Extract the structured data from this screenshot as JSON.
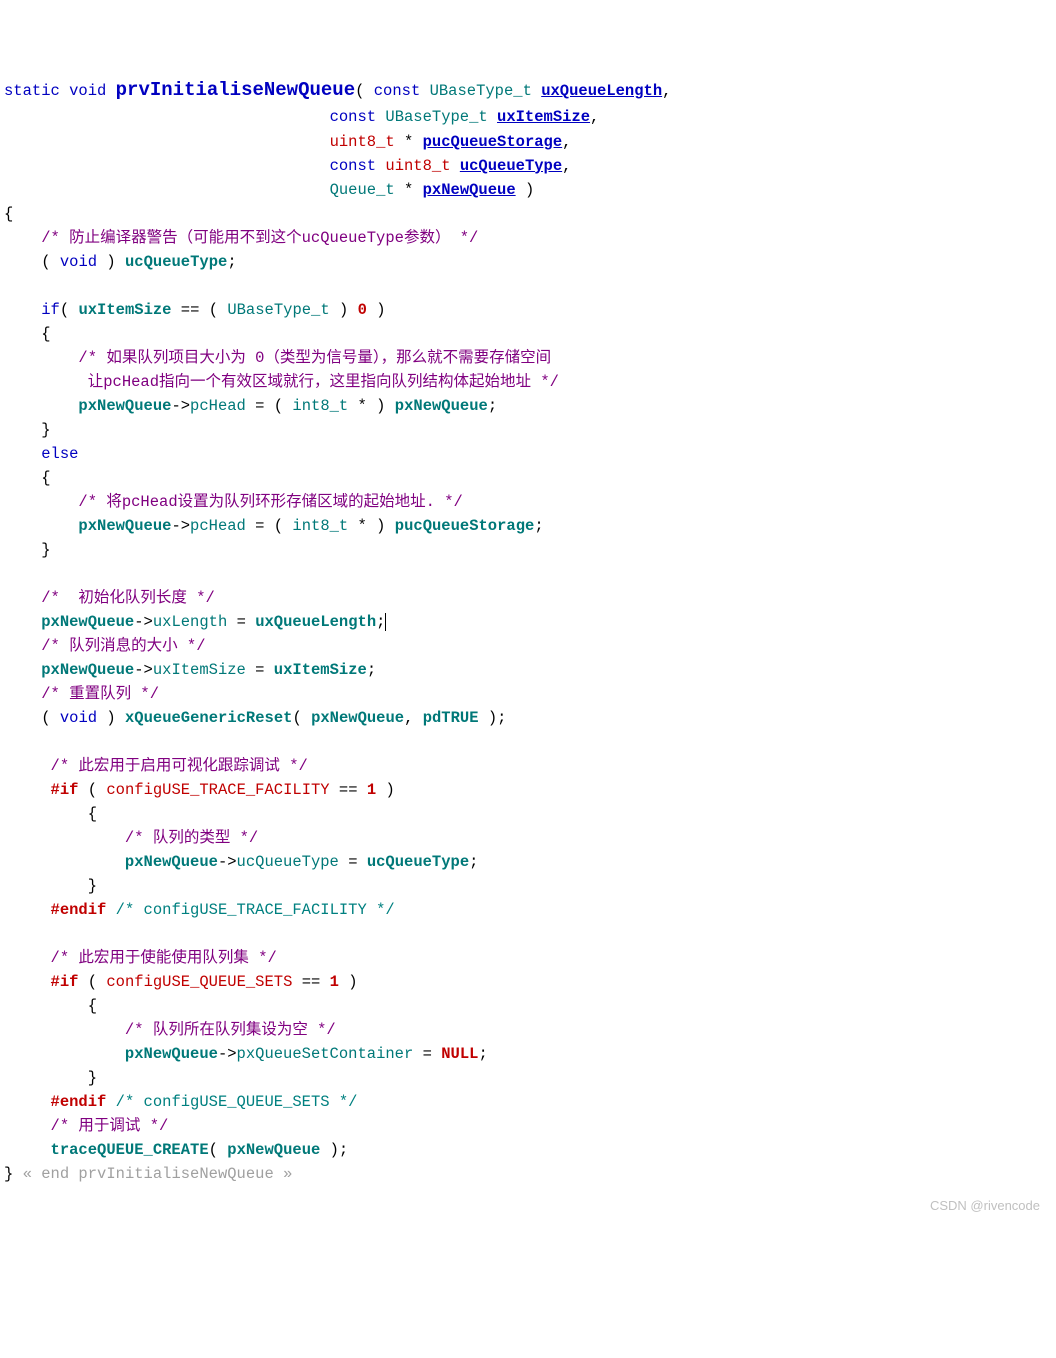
{
  "tokens": {
    "static": "static",
    "void": "void",
    "fnname": "prvInitialiseNewQueue",
    "const": "const",
    "UBaseType_t": "UBaseType_t",
    "uxQueueLength": "uxQueueLength",
    "uxItemSize": "uxItemSize",
    "uint8_t": "uint8_t",
    "pucQueueStorage": "pucQueueStorage",
    "ucQueueType": "ucQueueType",
    "Queue_t": "Queue_t",
    "pxNewQueue": "pxNewQueue",
    "if": "if",
    "else": "else",
    "zero": "0",
    "one": "1",
    "int8_t": "int8_t",
    "pcHead": "pcHead",
    "uxLength": "uxLength",
    "uxItemSize_m": "uxItemSize",
    "xQueueGenericReset": "xQueueGenericReset",
    "pdTRUE": "pdTRUE",
    "hash_if": "#if",
    "hash_endif": "#endif",
    "configUSE_TRACE_FACILITY": "configUSE_TRACE_FACILITY",
    "ucQueueType_m": "ucQueueType",
    "configUSE_QUEUE_SETS": "configUSE_QUEUE_SETS",
    "pxQueueSetContainer": "pxQueueSetContainer",
    "NULL": "NULL",
    "traceQUEUE_CREATE": "traceQUEUE_CREATE",
    "end_fold": "« end prvInitialiseNewQueue »"
  },
  "comments": {
    "c1": "/* 防止编译器警告（可能用不到这个ucQueueType参数） */",
    "c2": "/* 如果队列项目大小为 0（类型为信号量），那么就不需要存储空间",
    "c2b": " 让pcHead指向一个有效区域就行，这里指向队列结构体起始地址 */",
    "c3": "/* 将pcHead设置为队列环形存储区域的起始地址. */",
    "c4": "/*  初始化队列长度 */",
    "c5": "/* 队列消息的大小 */",
    "c6": "/* 重置队列 */",
    "c7": "/* 此宏用于启用可视化跟踪调试 */",
    "c8": "/* 队列的类型 */",
    "c9": "/* configUSE_TRACE_FACILITY */",
    "c10": "/* 此宏用于使能使用队列集 */",
    "c11": "/* 队列所在队列集设为空 */",
    "c12": "/* configUSE_QUEUE_SETS */",
    "c13": "/* 用于调试 */"
  },
  "watermark": "CSDN @rivencode"
}
